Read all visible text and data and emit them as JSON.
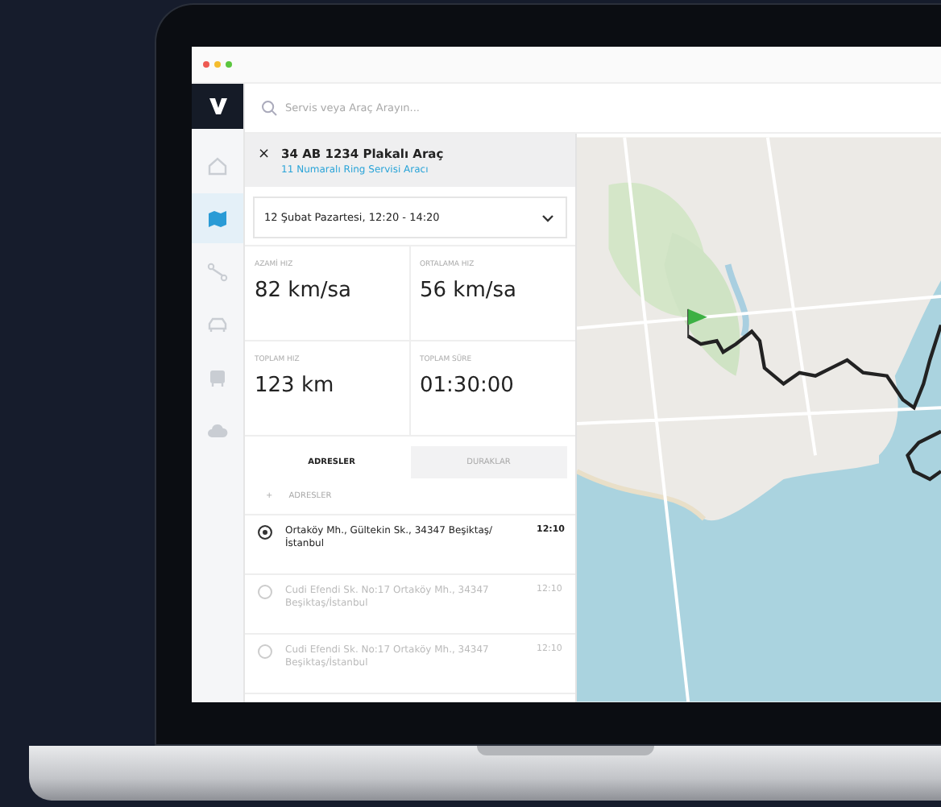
{
  "nav": [
    {
      "selected": false
    },
    {
      "selected": true
    },
    {
      "selected": false
    },
    {
      "selected": false
    },
    {
      "selected": false
    },
    {
      "selected": false
    }
  ],
  "search": {
    "placeholder": "Servis veya Araç Arayın..."
  },
  "vehicle": {
    "close": "×",
    "title": "34 AB 1234 Plakalı Araç",
    "subtitle": "11 Numaralı Ring Servisi Aracı"
  },
  "date_select": {
    "value": "12 Şubat Pazartesi, 12:20 - 14:20"
  },
  "stats": [
    {
      "label": "AZAMİ HIZ",
      "value": "82 km/sa"
    },
    {
      "label": "ORTALAMA HIZ",
      "value": "56 km/sa"
    },
    {
      "label": "TOPLAM HIZ",
      "value": "123 km"
    },
    {
      "label": "TOPLAM SÜRE",
      "value": "01:30:00"
    }
  ],
  "tabs": [
    {
      "label": "ADRESLER",
      "selected": true
    },
    {
      "label": "DURAKLAR",
      "selected": false
    }
  ],
  "section": {
    "mark": "+",
    "title": "ADRESLER"
  },
  "stops": [
    {
      "address": "Ortaköy Mh., Gültekin Sk., 34347 Beşiktaş/İstanbul",
      "time": "12:10",
      "active": true
    },
    {
      "address": "Cudi Efendi Sk. No:17 Ortaköy Mh., 34347 Beşiktaş/İstanbul",
      "time": "12:10",
      "active": false
    },
    {
      "address": "Cudi Efendi Sk. No:17 Ortaköy Mh., 34347 Beşiktaş/İstanbul",
      "time": "12:10",
      "active": false
    }
  ]
}
